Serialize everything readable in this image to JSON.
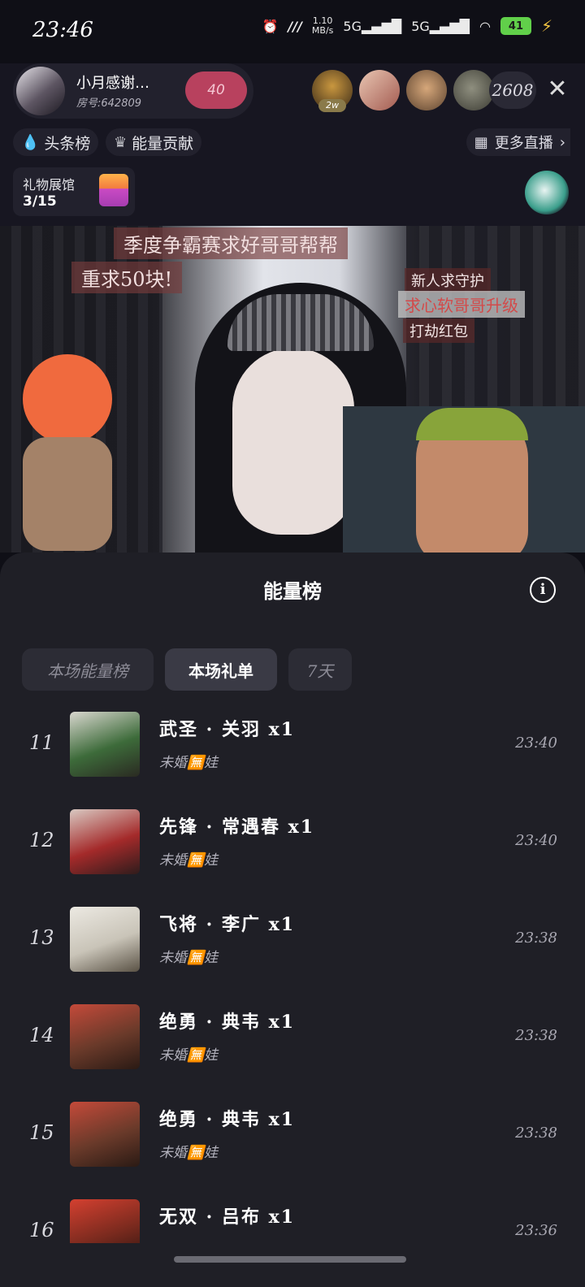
{
  "status_bar": {
    "time": "23:46",
    "speed_value": "1.10",
    "speed_unit": "MB/s",
    "network_1": "5G",
    "network_2": "5G",
    "battery": "41"
  },
  "live_header": {
    "host_name": "小月感谢…",
    "room_no": "房号:642809",
    "heart_level": "40",
    "viewer_badge": "2w",
    "viewer_count": "2608",
    "pill_headline": "头条榜",
    "pill_energy": "能量贡献",
    "more_live": "更多直播",
    "gift_hall_title": "礼物展馆",
    "gift_hall_count": "3/15"
  },
  "stream": {
    "banner_top": "季度争霸赛求好哥哥帮帮",
    "banner_left": "重求50块!",
    "banner_r1": "新人求守护",
    "banner_r2": "求心软哥哥升级",
    "banner_r3": "打劫红包"
  },
  "sheet": {
    "title": "能量榜",
    "tabs": [
      "本场能量榜",
      "本场礼单",
      "7天"
    ],
    "active_tab": 1
  },
  "gift_list": [
    {
      "rank": "11",
      "gift": "武圣 · 关羽  x1",
      "sender": "未婚🈚娃",
      "time": "23:40"
    },
    {
      "rank": "12",
      "gift": "先锋 · 常遇春  x1",
      "sender": "未婚🈚娃",
      "time": "23:40"
    },
    {
      "rank": "13",
      "gift": "飞将 · 李广  x1",
      "sender": "未婚🈚娃",
      "time": "23:38"
    },
    {
      "rank": "14",
      "gift": "绝勇 · 典韦  x1",
      "sender": "未婚🈚娃",
      "time": "23:38"
    },
    {
      "rank": "15",
      "gift": "绝勇 · 典韦  x1",
      "sender": "未婚🈚娃",
      "time": "23:38"
    },
    {
      "rank": "16",
      "gift": "无双 · 吕布  x1",
      "sender": "",
      "time": "23:36"
    }
  ]
}
